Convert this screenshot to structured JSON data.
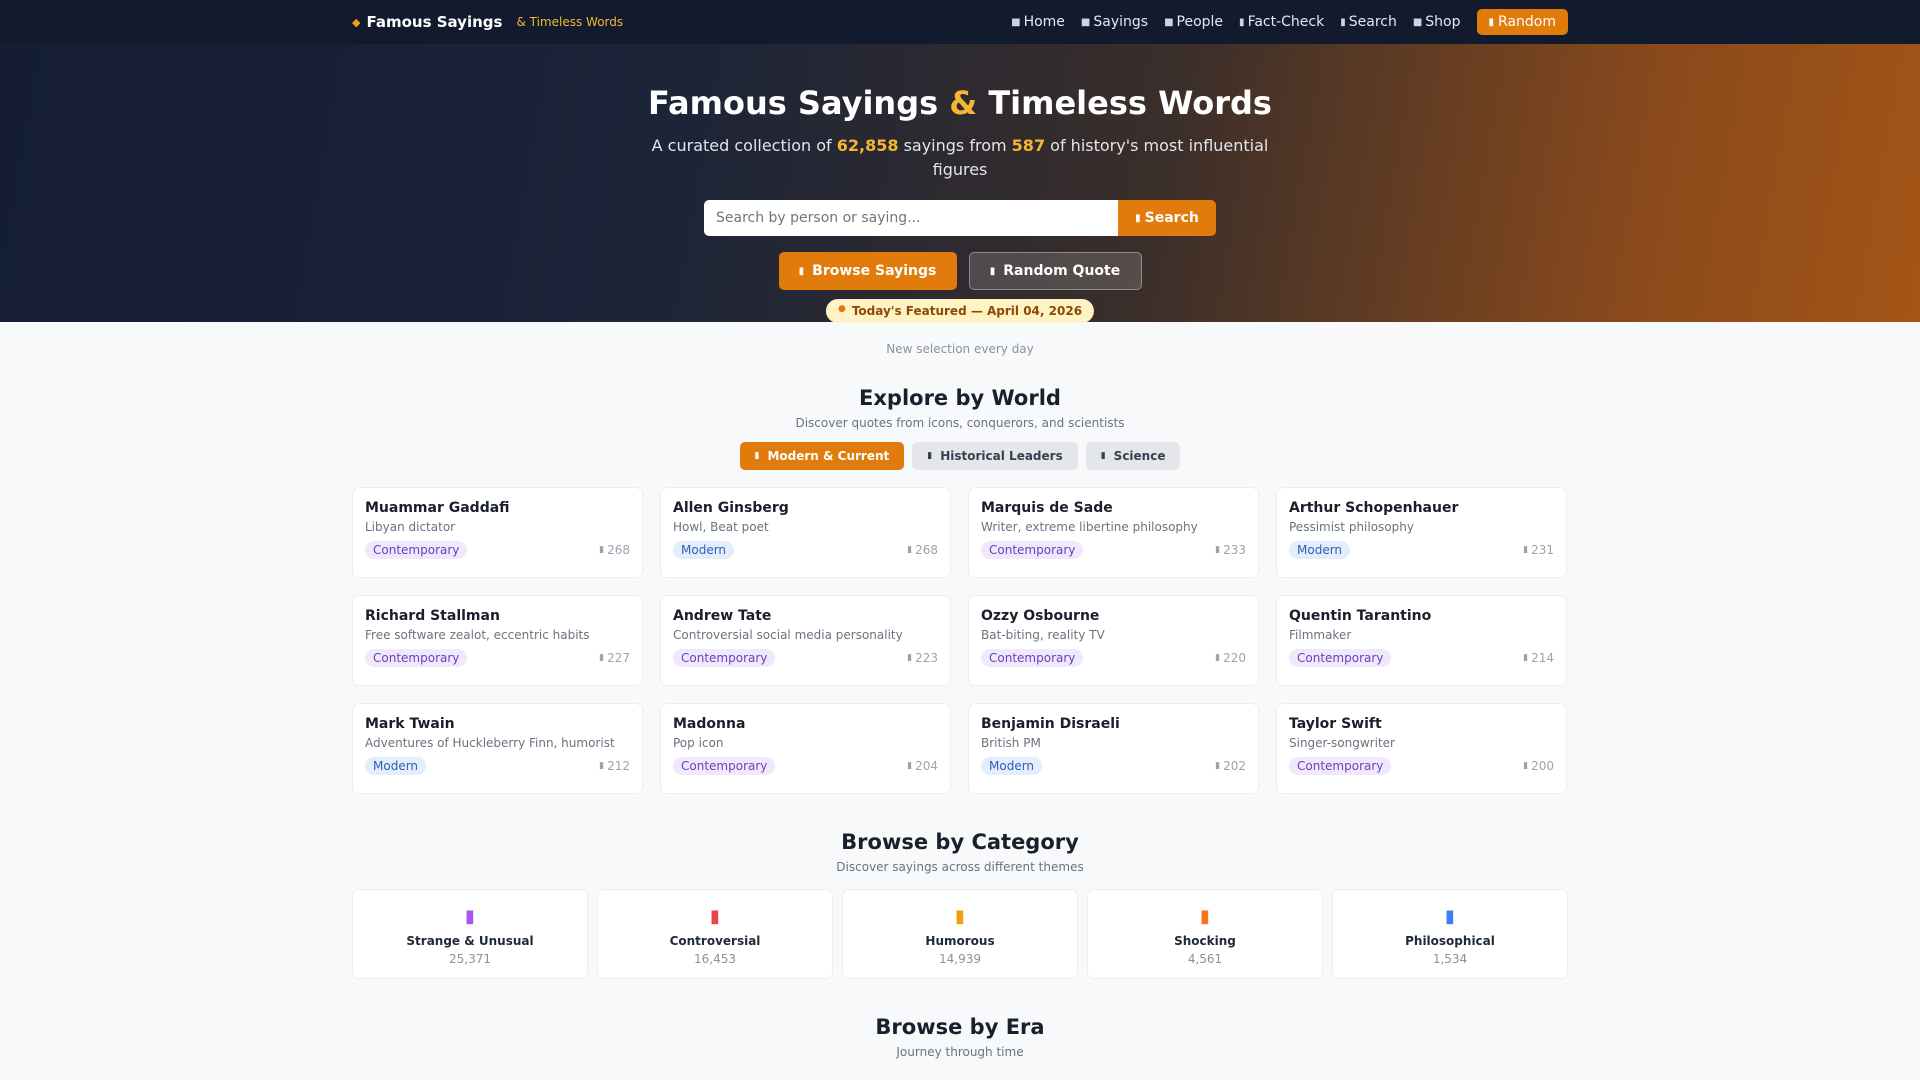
{
  "navbar": {
    "brand_name": "Famous Sayings",
    "brand_tag": "& Timeless Words",
    "links": [
      {
        "label": "Home",
        "icon": "home-icon"
      },
      {
        "label": "Sayings",
        "icon": "quote-icon"
      },
      {
        "label": "People",
        "icon": "people-icon"
      },
      {
        "label": "Fact-Check",
        "icon": "check-icon"
      },
      {
        "label": "Search",
        "icon": "search-icon"
      },
      {
        "label": "Shop",
        "icon": "shop-icon"
      }
    ],
    "random_label": "Random"
  },
  "hero": {
    "title_part1": "Famous Sayings",
    "title_amp": "&",
    "title_part2": "Timeless Words",
    "sub_prefix": "A curated collection of",
    "sayings_count": "62,858",
    "sub_middle": "sayings from",
    "people_count": "587",
    "sub_suffix": "of history's most influential figures",
    "search_placeholder": "Search by person or saying...",
    "search_button": "Search",
    "browse_button": "Browse Sayings",
    "random_button": "Random Quote",
    "featured_badge": "Today's Featured — April 04, 2026",
    "note": "New selection every day"
  },
  "explore": {
    "title": "Explore by World",
    "subtitle": "Discover quotes from icons, conquerors, and scientists",
    "tabs": [
      {
        "label": "Modern & Current",
        "active": true
      },
      {
        "label": "Historical Leaders",
        "active": false
      },
      {
        "label": "Science",
        "active": false
      }
    ],
    "people": [
      {
        "name": "Muammar Gaddafi",
        "desc": "Libyan dictator",
        "era": "Contemporary",
        "count": "268"
      },
      {
        "name": "Allen Ginsberg",
        "desc": "Howl, Beat poet",
        "era": "Modern",
        "count": "268"
      },
      {
        "name": "Marquis de Sade",
        "desc": "Writer, extreme libertine philosophy",
        "era": "Contemporary",
        "count": "233"
      },
      {
        "name": "Arthur Schopenhauer",
        "desc": "Pessimist philosophy",
        "era": "Modern",
        "count": "231"
      },
      {
        "name": "Richard Stallman",
        "desc": "Free software zealot, eccentric habits",
        "era": "Contemporary",
        "count": "227"
      },
      {
        "name": "Andrew Tate",
        "desc": "Controversial social media personality",
        "era": "Contemporary",
        "count": "223"
      },
      {
        "name": "Ozzy Osbourne",
        "desc": "Bat-biting, reality TV",
        "era": "Contemporary",
        "count": "220"
      },
      {
        "name": "Quentin Tarantino",
        "desc": "Filmmaker",
        "era": "Contemporary",
        "count": "214"
      },
      {
        "name": "Mark Twain",
        "desc": "Adventures of Huckleberry Finn, humorist",
        "era": "Modern",
        "count": "212"
      },
      {
        "name": "Madonna",
        "desc": "Pop icon",
        "era": "Contemporary",
        "count": "204"
      },
      {
        "name": "Benjamin Disraeli",
        "desc": "British PM",
        "era": "Modern",
        "count": "202"
      },
      {
        "name": "Taylor Swift",
        "desc": "Singer-songwriter",
        "era": "Contemporary",
        "count": "200"
      }
    ]
  },
  "category": {
    "title": "Browse by Category",
    "subtitle": "Discover sayings across different themes",
    "items": [
      {
        "name": "Strange & Unusual",
        "count": "25,371",
        "icon": "sparkle-icon",
        "color": "#a855f7"
      },
      {
        "name": "Controversial",
        "count": "16,453",
        "icon": "fire-icon",
        "color": "#ef4444"
      },
      {
        "name": "Humorous",
        "count": "14,939",
        "icon": "laugh-icon",
        "color": "#f59e0b"
      },
      {
        "name": "Shocking",
        "count": "4,561",
        "icon": "bolt-icon",
        "color": "#f97316"
      },
      {
        "name": "Philosophical",
        "count": "1,534",
        "icon": "brain-icon",
        "color": "#3b82f6"
      }
    ]
  },
  "era": {
    "title": "Browse by Era",
    "subtitle": "Journey through time"
  },
  "colors": {
    "accent": "#e07b0c",
    "highlight": "#f5b731",
    "nav_bg": "#121a2e"
  }
}
